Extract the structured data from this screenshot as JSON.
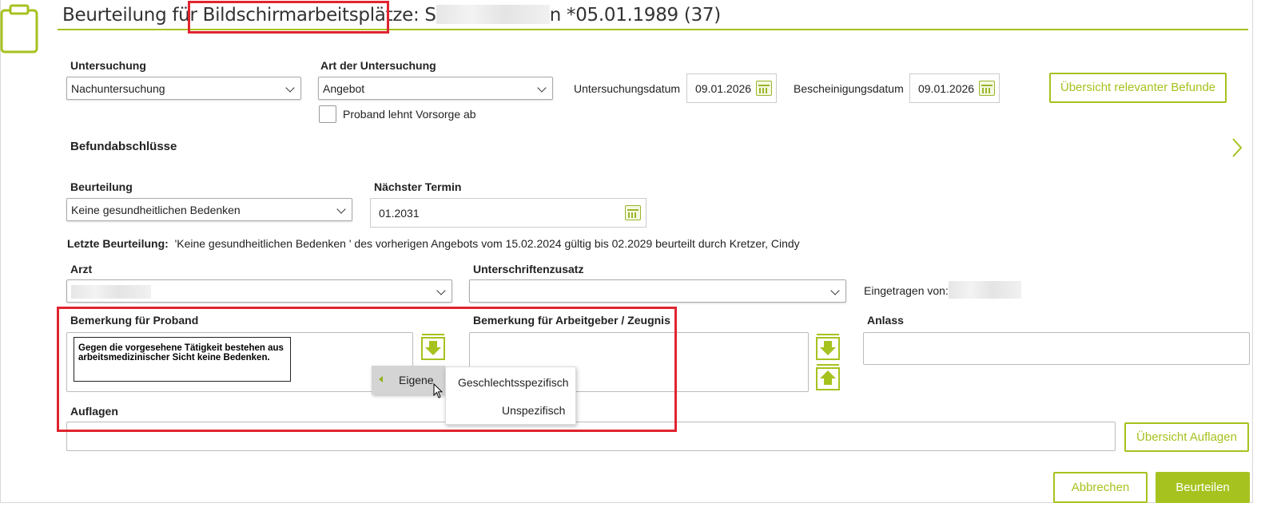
{
  "header": {
    "title": "Beurteilung für Bildschirmarbeitsplätze: S",
    "title_suffix": "n *05.01.1989 (37)"
  },
  "examination": {
    "untersuchung_label": "Untersuchung",
    "untersuchung_value": "Nachuntersuchung",
    "art_label": "Art der Untersuchung",
    "art_value": "Angebot",
    "proband_lehnt_label": "Proband lehnt Vorsorge ab",
    "untersuchungsdatum_label": "Untersuchungsdatum",
    "untersuchungsdatum_value": "09.01.2026",
    "bescheinigungsdatum_label": "Bescheinigungsdatum",
    "bescheinigungsdatum_value": "09.01.2026",
    "befunde_button": "Übersicht relevanter Befunde"
  },
  "befundabschluesse": {
    "heading": "Befundabschlüsse"
  },
  "assessment": {
    "beurteilung_label": "Beurteilung",
    "beurteilung_value": "Keine gesundheitlichen Bedenken",
    "naechster_termin_label": "Nächster Termin",
    "naechster_termin_value": "01.2031",
    "letzte_label": "Letzte Beurteilung:",
    "letzte_text": "'Keine gesundheitlichen Bedenken ' des vorherigen Angebots  vom 15.02.2024 gültig bis 02.2029 beurteilt durch Kretzer, Cindy"
  },
  "signature": {
    "arzt_label": "Arzt",
    "unterschrift_label": "Unterschriftenzusatz",
    "eingetragen_label": "Eingetragen von:"
  },
  "remarks": {
    "proband_label": "Bemerkung für Proband",
    "proband_text": "Gegen die vorgesehene Tätigkeit bestehen aus arbeitsmedizinischer Sicht keine Bedenken.",
    "arbeitgeber_label": "Bemerkung für Arbeitgeber / Zeugnis",
    "anlass_label": "Anlass",
    "auflagen_label": "Auflagen",
    "auflagen_button": "Übersicht Auflagen"
  },
  "context_menu": {
    "parent_item": "Eigene",
    "items": [
      "Geschlechtsspezifisch",
      "Unspezifisch"
    ]
  },
  "footer": {
    "cancel": "Abbrechen",
    "submit": "Beurteilen"
  },
  "colors": {
    "accent": "#a6c21f",
    "highlight": "#e0242f"
  },
  "icons": [
    "clipboard-icon",
    "calendar-icon",
    "chevron-down-icon",
    "chevron-right-icon",
    "template-import-icon",
    "template-export-icon",
    "mouse-cursor-icon"
  ]
}
